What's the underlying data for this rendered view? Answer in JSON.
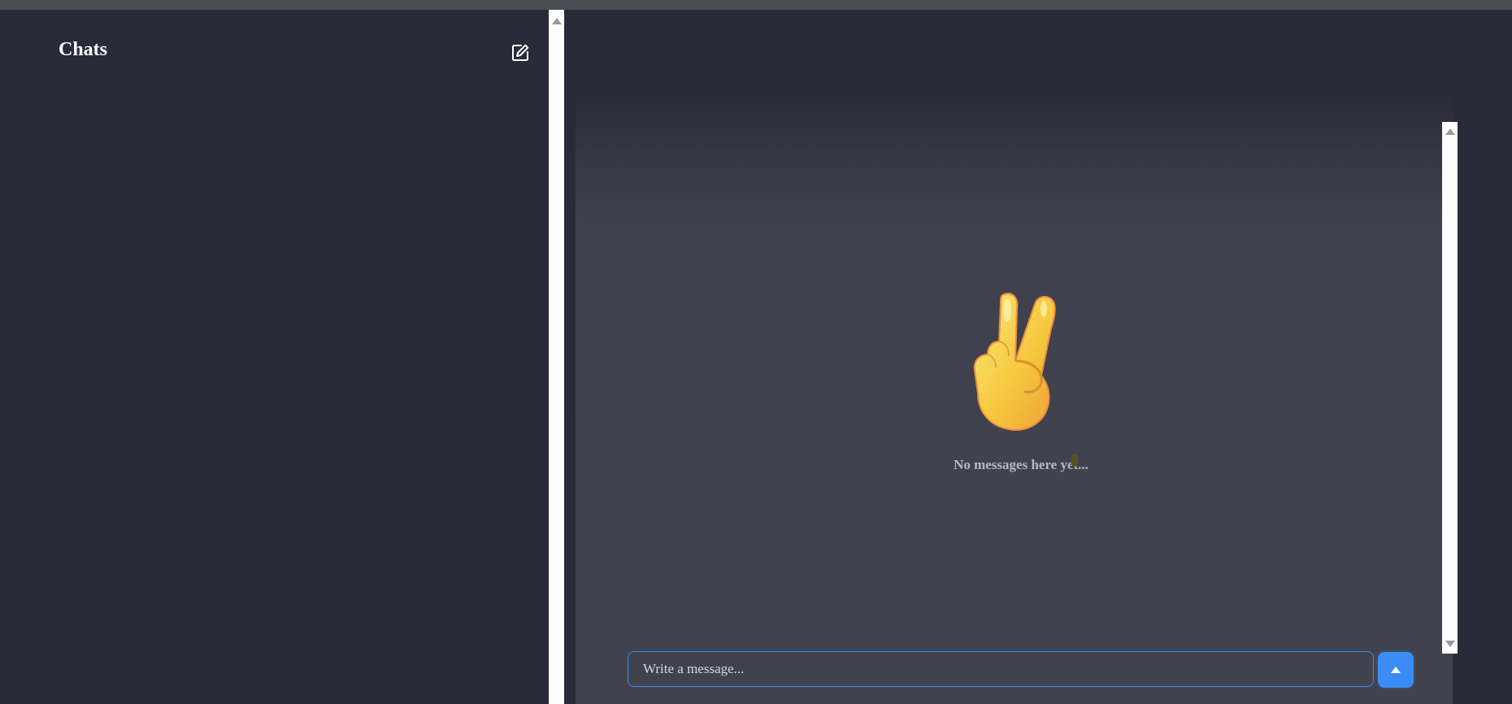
{
  "sidebar": {
    "title": "Chats",
    "compose_icon": "compose-edit-icon"
  },
  "chat": {
    "empty_state_emoji": "victory-hand-emoji",
    "empty_state_text": "No messages here yet...",
    "input_placeholder": "Write a message...",
    "send_icon": "send-arrow-up-icon"
  },
  "colors": {
    "background": "#292c38",
    "panel": "#40424e",
    "accent": "#3b8cf5",
    "text": "#ffffff",
    "muted_text": "#b7b8c0"
  }
}
